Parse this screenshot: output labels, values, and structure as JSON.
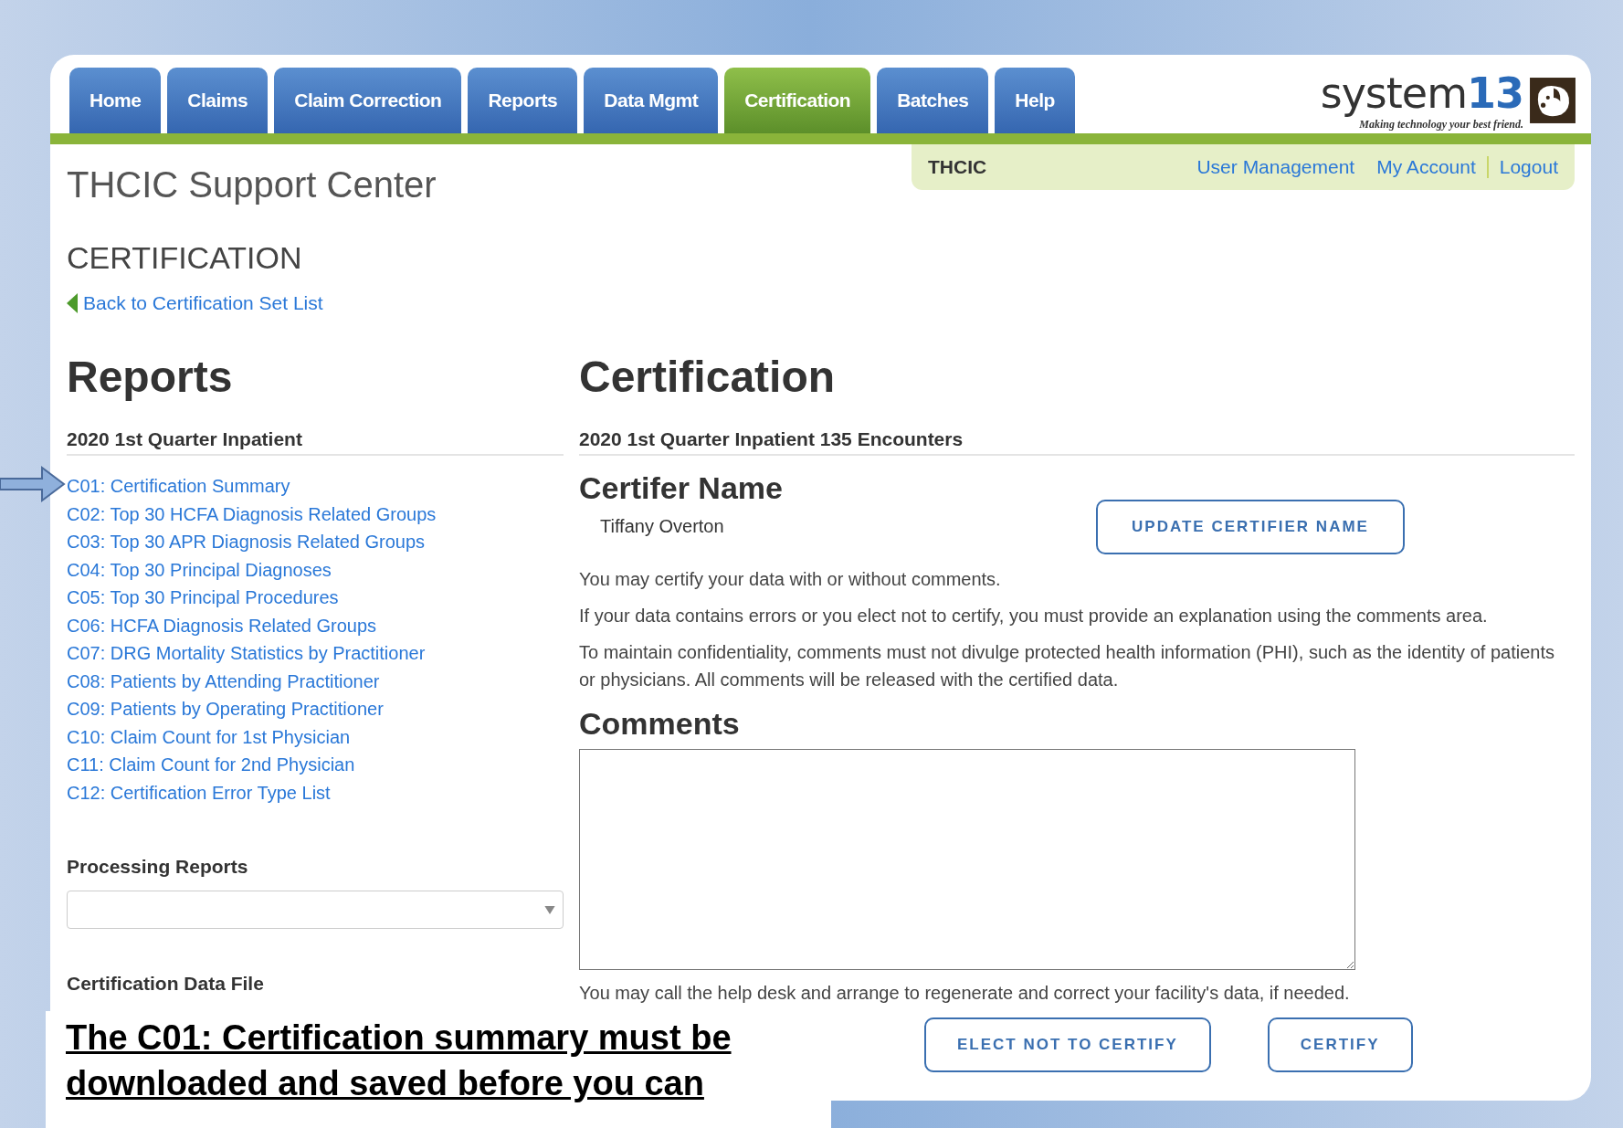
{
  "nav": {
    "tabs": [
      {
        "label": "Home",
        "selected": false
      },
      {
        "label": "Claims",
        "selected": false
      },
      {
        "label": "Claim Correction",
        "selected": false
      },
      {
        "label": "Reports",
        "selected": false
      },
      {
        "label": "Data Mgmt",
        "selected": false
      },
      {
        "label": "Certification",
        "selected": true
      },
      {
        "label": "Batches",
        "selected": false
      },
      {
        "label": "Help",
        "selected": false
      }
    ]
  },
  "logo": {
    "text": "system",
    "number": "13",
    "tagline": "Making technology your best friend."
  },
  "user_bar": {
    "org": "THCIC",
    "links": [
      "User Management",
      "My Account",
      "Logout"
    ]
  },
  "site_title": "THCIC Support Center",
  "page_title": "CERTIFICATION",
  "back_link": "Back to Certification Set List",
  "reports": {
    "heading": "Reports",
    "subheading": "2020 1st Quarter Inpatient",
    "links": [
      "C01: Certification Summary",
      "C02: Top 30 HCFA Diagnosis Related Groups",
      "C03: Top 30 APR Diagnosis Related Groups",
      "C04: Top 30 Principal Diagnoses",
      "C05: Top 30 Principal Procedures",
      "C06: HCFA Diagnosis Related Groups",
      "C07: DRG Mortality Statistics by Practitioner",
      "C08: Patients by Attending Practitioner",
      "C09: Patients by Operating Practitioner",
      "C10: Claim Count for 1st Physician",
      "C11: Claim Count for 2nd Physician",
      "C12: Certification Error Type List"
    ],
    "processing_reports": {
      "label": "Processing Reports"
    },
    "data_file_label": "Certification Data File"
  },
  "certification": {
    "heading": "Certification",
    "subheading": "2020 1st Quarter Inpatient 135 Encounters",
    "certifier_heading": "Certifer Name",
    "certifier_name": "Tiffany Overton",
    "update_button": "UPDATE CERTIFIER NAME",
    "paragraphs": [
      "You may certify your data with or without comments.",
      "If your data contains errors or you elect not to certify, you must provide an explanation using the comments area.",
      "To maintain confidentiality, comments must not divulge protected health information (PHI), such as the identity of patients or physicians. All comments will be released with the certified data."
    ],
    "comments_heading": "Comments",
    "help_text": "You may call the help desk and arrange to regenerate and correct your facility's data, if needed.",
    "buttons": [
      "ELECT NOT TO CERTIFY",
      "CERTIFY"
    ]
  },
  "annotation": {
    "text": "The C01: Certification summary must be downloaded and saved before you can"
  }
}
